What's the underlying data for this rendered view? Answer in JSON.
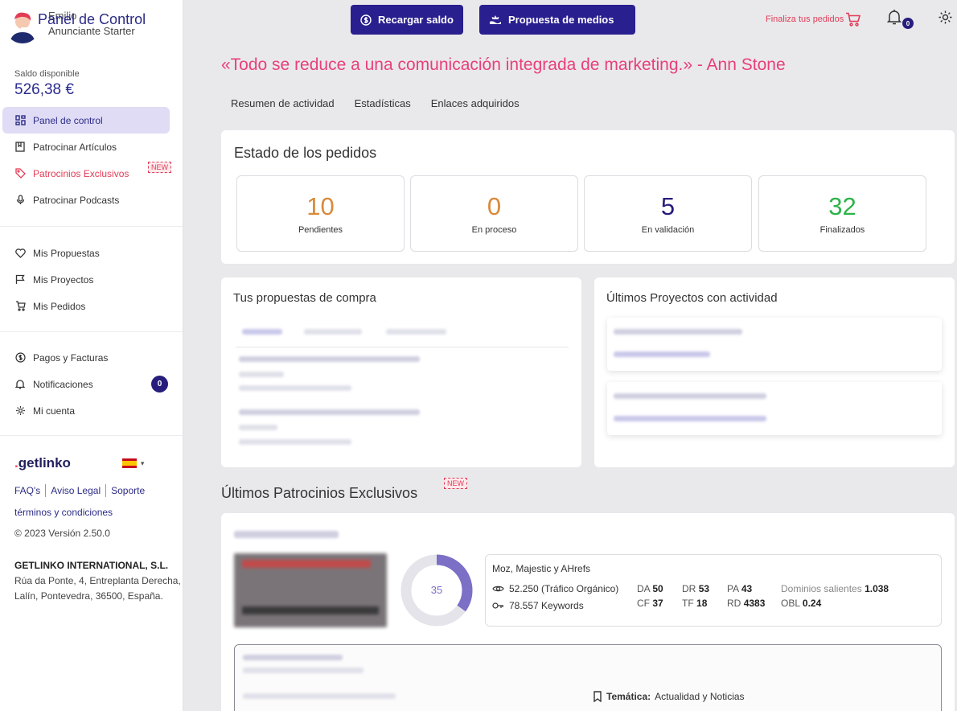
{
  "user": {
    "name": "Emilio",
    "role": "Anunciante Starter"
  },
  "balance": {
    "label": "Saldo disponible",
    "value": "526,38 €"
  },
  "nav": {
    "main": [
      {
        "label": "Panel de control"
      },
      {
        "label": "Patrocinar Artículos"
      },
      {
        "label": "Patrocinios Exclusivos",
        "tag": "NEW"
      },
      {
        "label": "Patrocinar Podcasts"
      }
    ],
    "mine": [
      {
        "label": "Mis Propuestas"
      },
      {
        "label": "Mis Proyectos"
      },
      {
        "label": "Mis Pedidos"
      }
    ],
    "account": [
      {
        "label": "Pagos y Facturas"
      },
      {
        "label": "Notificaciones",
        "badge": "0"
      },
      {
        "label": "Mi cuenta"
      }
    ]
  },
  "footer": {
    "brand": "getlinko",
    "faq": "FAQ's",
    "legal": "Aviso Legal",
    "support": "Soporte",
    "terms": "términos y condiciones",
    "copyright": "© 2023 Versión 2.50.0",
    "company": "GETLINKO INTERNATIONAL, S.L.",
    "address": "Rúa da Ponte, 4, Entreplanta Derecha, Lalín, Pontevedra, 36500, España."
  },
  "header": {
    "title": "Panel de Control",
    "recharge_label": "Recargar saldo",
    "media_label": "Propuesta de medios",
    "finish_label": "Finaliza tus pedidos",
    "bell_count": "0"
  },
  "quote": "«Todo se reduce a una comunicación integrada de marketing.» - Ann Stone",
  "tabs": [
    "Resumen de actividad",
    "Estadísticas",
    "Enlaces adquiridos"
  ],
  "orders": {
    "title": "Estado de los pedidos",
    "stats": [
      {
        "value": "10",
        "label": "Pendientes",
        "color": "#d98a3a"
      },
      {
        "value": "0",
        "label": "En proceso",
        "color": "#d98a3a"
      },
      {
        "value": "5",
        "label": "En validación",
        "color": "#261d7c"
      },
      {
        "value": "32",
        "label": "Finalizados",
        "color": "#2db34a"
      }
    ]
  },
  "proposals": {
    "title": "Tus propuestas de compra"
  },
  "projects": {
    "title": "Últimos Proyectos con actividad"
  },
  "exclusive": {
    "title": "Últimos Patrocinios Exclusivos",
    "tag": "NEW",
    "score": "35",
    "score_fraction": 0.35,
    "metrics": {
      "title": "Moz, Majestic y AHrefs",
      "traffic": "52.250 (Tráfico Orgánico)",
      "keywords": "78.557 Keywords",
      "da_label": "DA",
      "da": "50",
      "cf_label": "CF",
      "cf": "37",
      "dr_label": "DR",
      "dr": "53",
      "tf_label": "TF",
      "tf": "18",
      "pa_label": "PA",
      "pa": "43",
      "rd_label": "RD",
      "rd": "4383",
      "out_label": "Dominios salientes",
      "out": "1.038",
      "obl_label": "OBL",
      "obl": "0.24"
    },
    "topic_label": "Temática:",
    "topic_value": "Actualidad y Noticias"
  },
  "colors": {
    "brand": "#2a1f8f",
    "accent": "#e93f78",
    "active_bg": "#e0dcf6"
  }
}
